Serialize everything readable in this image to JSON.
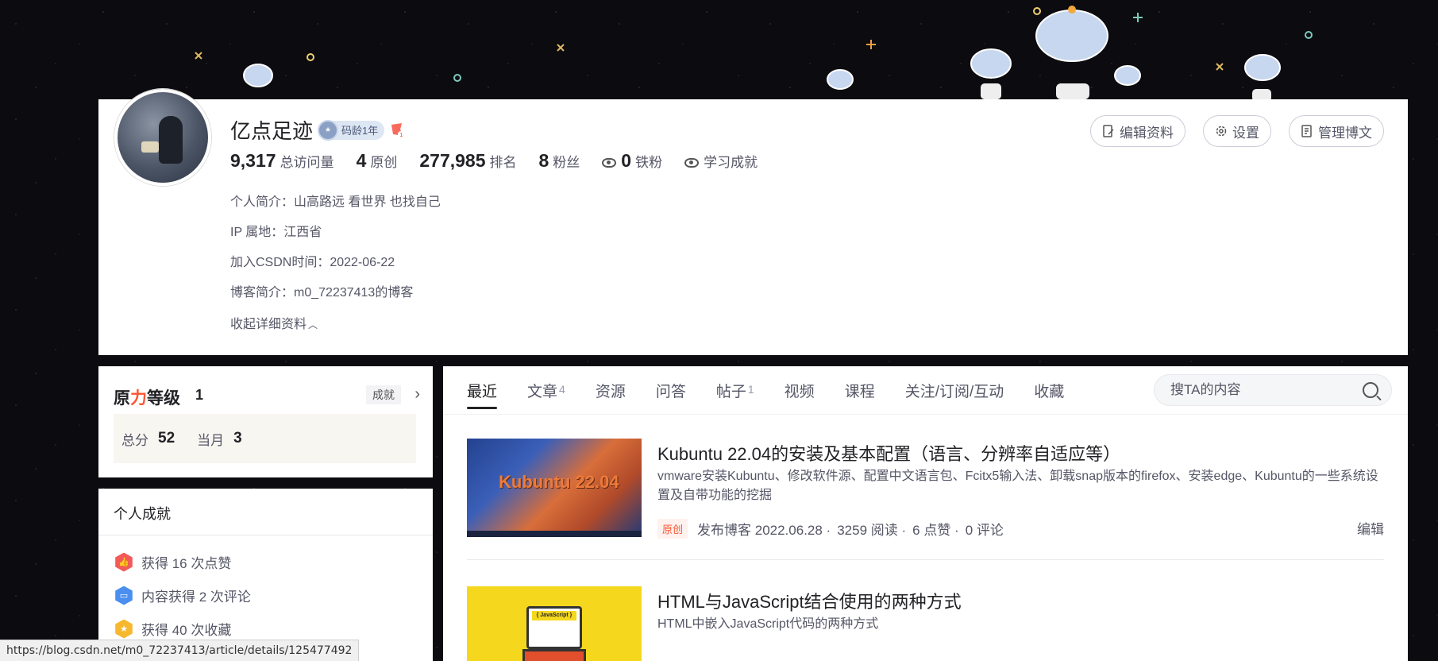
{
  "colors": {
    "accent": "#fc5531",
    "text": "#222226",
    "muted": "#555666"
  },
  "profile": {
    "name": "亿点足迹",
    "age_badge": "码龄1年",
    "stats": [
      {
        "value": "9,317",
        "label": "总访问量"
      },
      {
        "value": "4",
        "label": "原创"
      },
      {
        "value": "277,985",
        "label": "排名"
      },
      {
        "value": "8",
        "label": "粉丝"
      },
      {
        "value": "0",
        "label": "铁粉"
      }
    ],
    "learning_achievement": "学习成就",
    "bio_label": "个人简介：",
    "bio": "山高路远 看世界 也找自己",
    "ip_label": "IP 属地：",
    "ip": "江西省",
    "joined_label": "加入CSDN时间：",
    "joined": "2022-06-22",
    "blog_label": "博客简介：",
    "blog": "m0_72237413的博客",
    "collapse": "收起详细资料"
  },
  "actions": {
    "edit_profile": "编辑资料",
    "settings": "设置",
    "manage_posts": "管理博文"
  },
  "level": {
    "title_part1": "原",
    "title_part2": "力",
    "title_part3": "等级",
    "value": "1",
    "achievements_tag": "成就",
    "total_label": "总分",
    "total": "52",
    "month_label": "当月",
    "month": "3"
  },
  "achievements": {
    "title": "个人成就",
    "items": [
      {
        "text": "获得 16 次点赞",
        "icon": "thumb-up-icon",
        "color": "#f25a5a"
      },
      {
        "text": "内容获得 2 次评论",
        "icon": "comment-icon",
        "color": "#4a8ff0"
      },
      {
        "text": "获得 40 次收藏",
        "icon": "star-icon",
        "color": "#f5b82e"
      }
    ]
  },
  "tabs": [
    {
      "label": "最近",
      "count": ""
    },
    {
      "label": "文章",
      "count": "4"
    },
    {
      "label": "资源",
      "count": ""
    },
    {
      "label": "问答",
      "count": ""
    },
    {
      "label": "帖子",
      "count": "1"
    },
    {
      "label": "视频",
      "count": ""
    },
    {
      "label": "课程",
      "count": ""
    },
    {
      "label": "关注/订阅/互动",
      "count": ""
    },
    {
      "label": "收藏",
      "count": ""
    }
  ],
  "search": {
    "placeholder": "搜TA的内容"
  },
  "articles": [
    {
      "thumb_text": "Kubuntu 22.04",
      "title": "Kubuntu 22.04的安装及基本配置（语言、分辨率自适应等）",
      "desc": "vmware安装Kubuntu、修改软件源、配置中文语言包、Fcitx5输入法、卸载snap版本的firefox、安装edge、Kubuntu的一些系统设置及自带功能的挖掘",
      "tag": "原创",
      "published": "发布博客 2022.06.28 ·",
      "reads": "3259 阅读 ·",
      "likes": "6 点赞 ·",
      "comments": "0 评论",
      "edit": "编辑"
    },
    {
      "thumb_text": "{ JavaScript }",
      "title": "HTML与JavaScript结合使用的两种方式",
      "desc": "HTML中嵌入JavaScript代码的两种方式"
    }
  ],
  "statusbar": {
    "url": "https://blog.csdn.net/m0_72237413/article/details/125477492"
  }
}
